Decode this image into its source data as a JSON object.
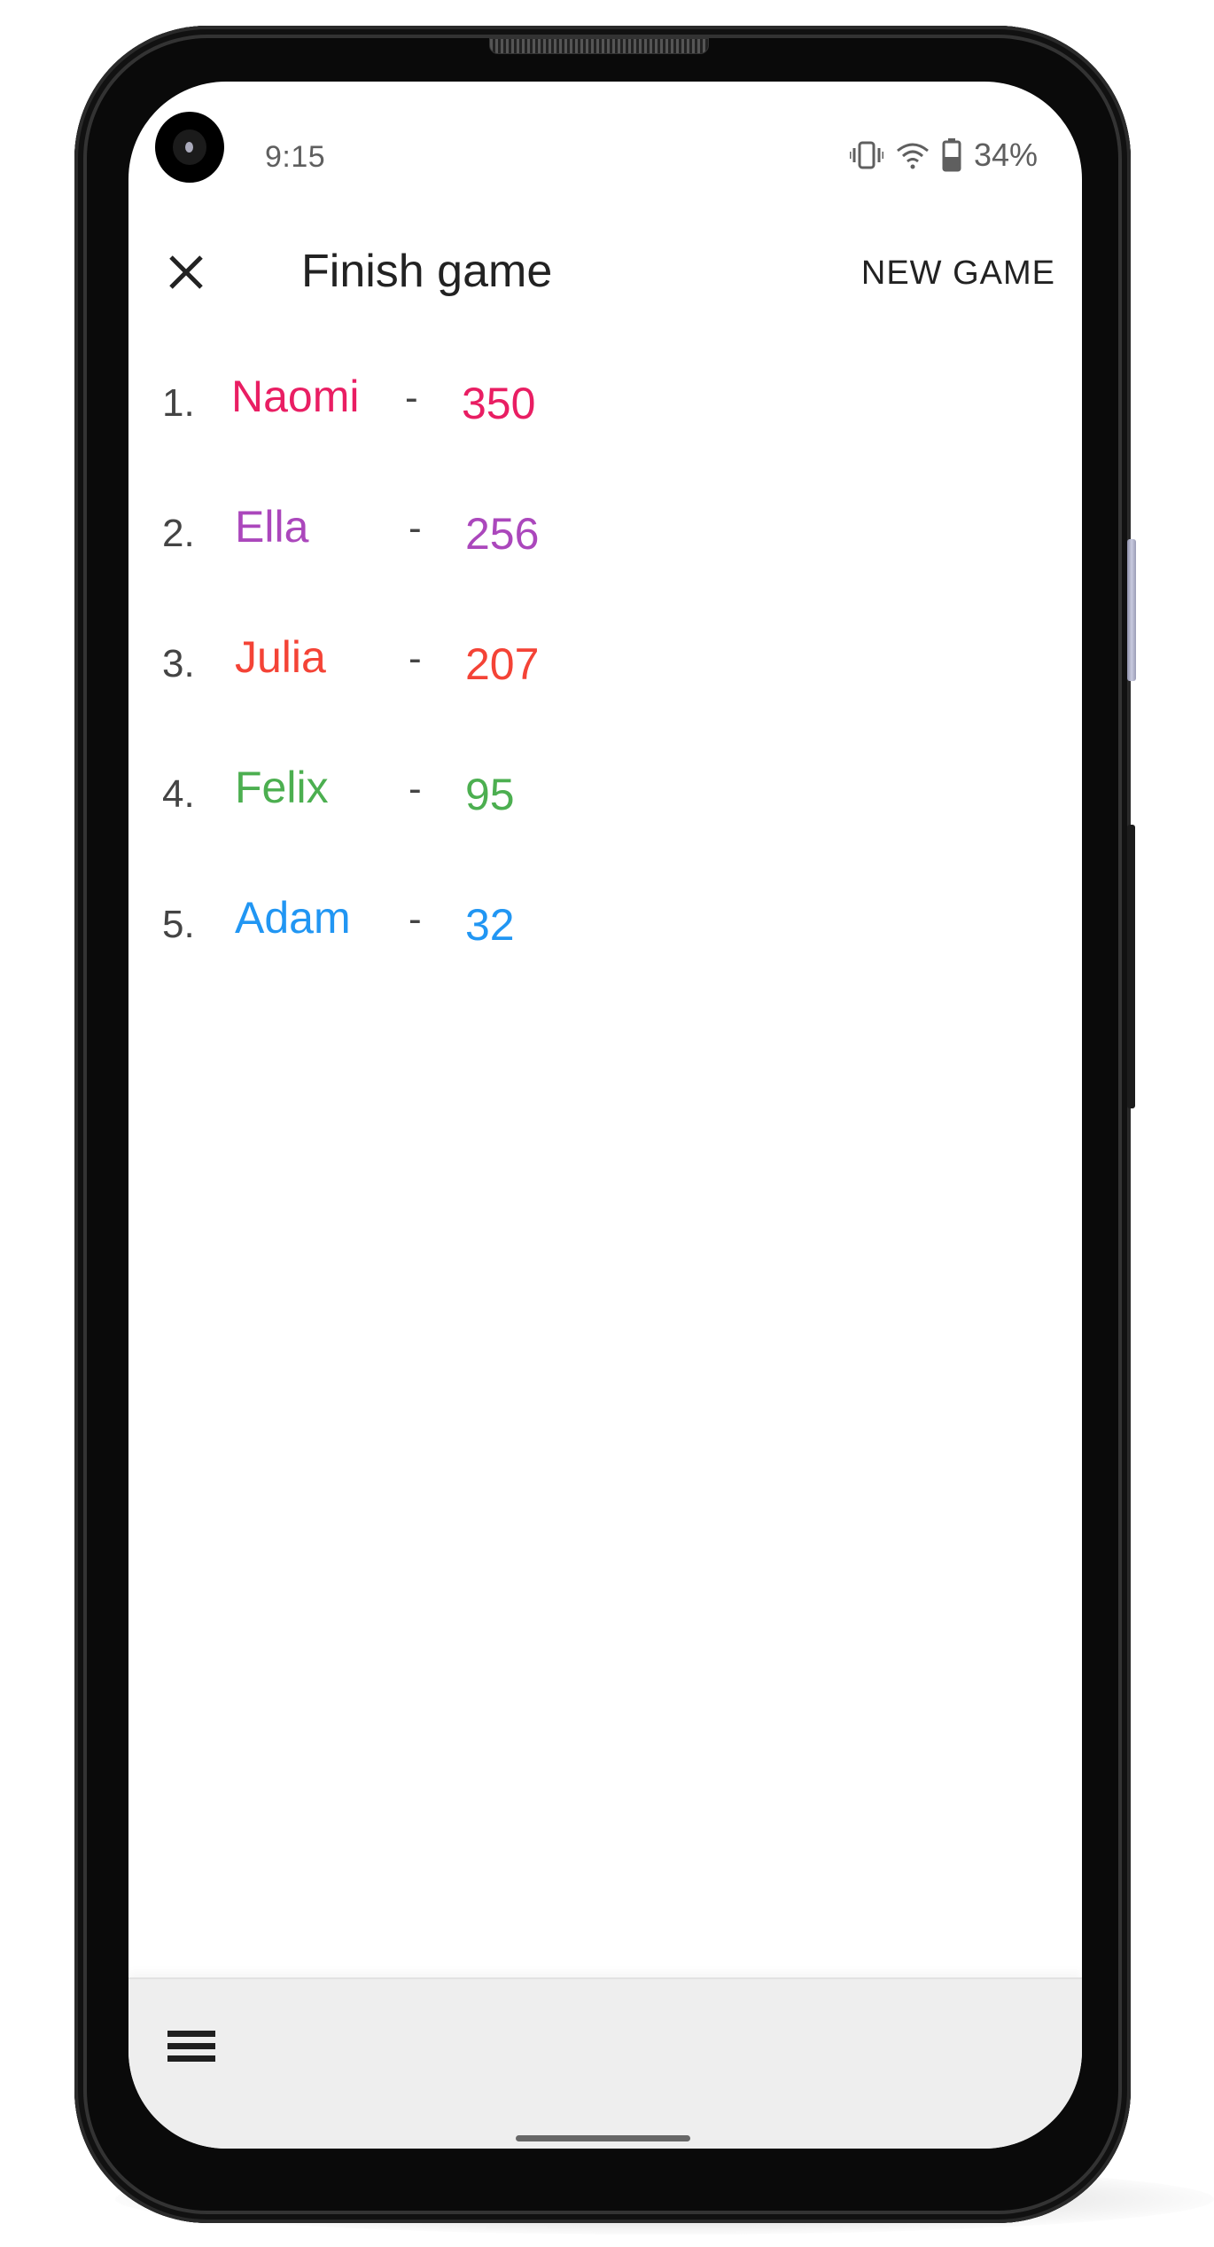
{
  "status_bar": {
    "time": "9:15",
    "battery_percent": "34%",
    "icons": [
      "vibrate-icon",
      "wifi-icon",
      "battery-icon"
    ]
  },
  "app_bar": {
    "close_icon": "close-icon",
    "title": "Finish game",
    "action_label": "NEW GAME"
  },
  "leaderboard": [
    {
      "rank": "1.",
      "name": "Naomi",
      "separator": "-",
      "score": "350",
      "color": "#E91E63"
    },
    {
      "rank": "2.",
      "name": "Ella",
      "separator": "-",
      "score": "256",
      "color": "#AB47BC"
    },
    {
      "rank": "3.",
      "name": "Julia",
      "separator": "-",
      "score": "207",
      "color": "#F44336"
    },
    {
      "rank": "4.",
      "name": "Felix",
      "separator": "-",
      "score": "95",
      "color": "#4CAF50"
    },
    {
      "rank": "5.",
      "name": "Adam",
      "separator": "-",
      "score": "32",
      "color": "#2196F3"
    }
  ],
  "bottom_bar": {
    "menu_icon": "menu-icon"
  }
}
